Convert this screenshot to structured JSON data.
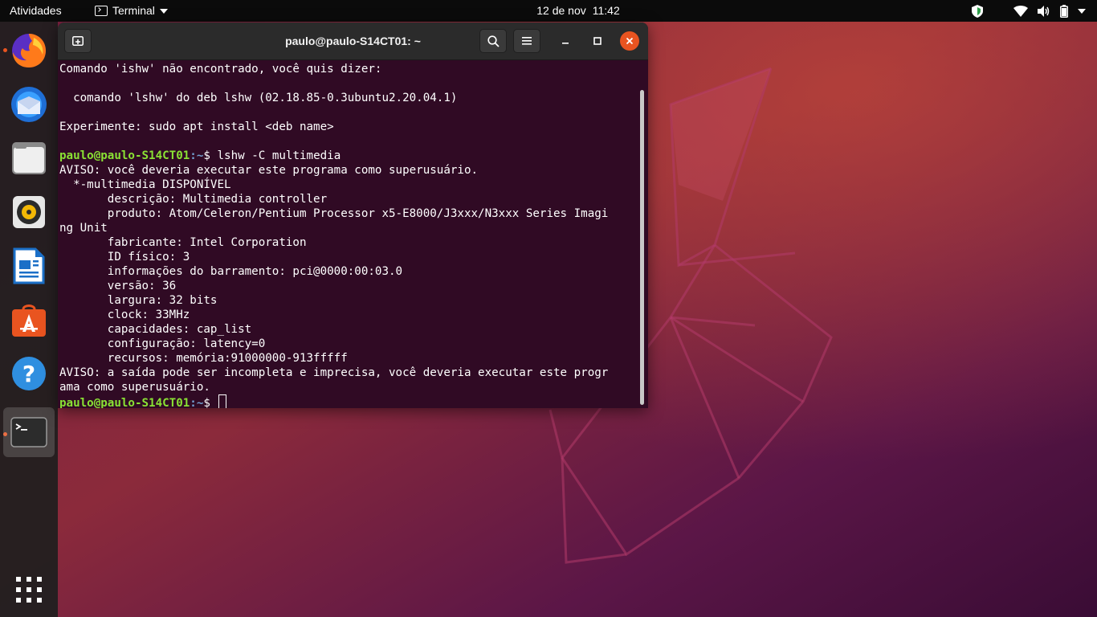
{
  "topbar": {
    "activities": "Atividades",
    "app_name": "Terminal",
    "date": "12 de nov",
    "time": "11:42",
    "tray_icons": [
      "shield-icon",
      "wifi-icon",
      "volume-icon",
      "battery-icon",
      "power-menu-icon"
    ]
  },
  "dock": {
    "items": [
      {
        "name": "firefox",
        "icon": "firefox-icon",
        "running": true
      },
      {
        "name": "thunderbird",
        "icon": "thunderbird-icon",
        "running": false
      },
      {
        "name": "files",
        "icon": "files-icon",
        "running": false
      },
      {
        "name": "rhythmbox",
        "icon": "rhythmbox-icon",
        "running": false
      },
      {
        "name": "libreoffice-writer",
        "icon": "writer-icon",
        "running": false
      },
      {
        "name": "ubuntu-software",
        "icon": "software-icon",
        "running": false
      },
      {
        "name": "help",
        "icon": "help-icon",
        "running": false
      },
      {
        "name": "terminal",
        "icon": "terminal-icon",
        "running": true
      }
    ],
    "show_apps_icon": "grid-icon"
  },
  "window": {
    "title": "paulo@paulo-S14CT01: ~",
    "colors": {
      "background": "#300a24",
      "user": "#8ae234",
      "path": "#729fcf",
      "close": "#e95420"
    }
  },
  "terminal": {
    "prompt_user": "paulo@paulo-S14CT01",
    "prompt_sep": ":",
    "prompt_path": "~",
    "prompt_end": "$ ",
    "lines": [
      {
        "text": "Comando 'ishw' não encontrado, você quis dizer:"
      },
      {
        "text": ""
      },
      {
        "text": "  comando 'lshw' do deb lshw (02.18.85-0.3ubuntu2.20.04.1)"
      },
      {
        "text": ""
      },
      {
        "text": "Experimente: sudo apt install <deb name>"
      },
      {
        "text": ""
      },
      {
        "prompt": true,
        "text": "lshw -C multimedia"
      },
      {
        "text": "AVISO: você deveria executar este programa como superusuário."
      },
      {
        "text": "  *-multimedia DISPONÍVEL"
      },
      {
        "text": "       descrição: Multimedia controller"
      },
      {
        "text": "       produto: Atom/Celeron/Pentium Processor x5-E8000/J3xxx/N3xxx Series Imagi"
      },
      {
        "text": "ng Unit"
      },
      {
        "text": "       fabricante: Intel Corporation"
      },
      {
        "text": "       ID físico: 3"
      },
      {
        "text": "       informações do barramento: pci@0000:00:03.0"
      },
      {
        "text": "       versão: 36"
      },
      {
        "text": "       largura: 32 bits"
      },
      {
        "text": "       clock: 33MHz"
      },
      {
        "text": "       capacidades: cap_list"
      },
      {
        "text": "       configuração: latency=0"
      },
      {
        "text": "       recursos: memória:91000000-913fffff"
      },
      {
        "text": "AVISO: a saída pode ser incompleta e imprecisa, você deveria executar este progr"
      },
      {
        "text": "ama como superusuário."
      },
      {
        "prompt": true,
        "text": "",
        "cursor": true
      }
    ]
  }
}
